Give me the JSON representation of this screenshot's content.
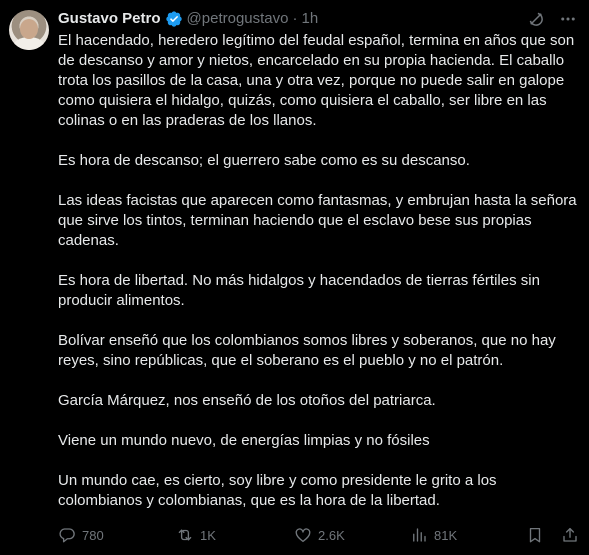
{
  "tweet": {
    "author_name": "Gustavo Petro",
    "handle": "@petrogustavo",
    "separator": "·",
    "timestamp": "1h",
    "paragraphs": [
      "El hacendado, heredero legítimo del feudal español, termina en años que son de descanso y amor y nietos, encarcelado en su propia hacienda. El caballo trota los pasillos de la casa, una y otra vez, porque no puede salir en galope como quisiera el hidalgo,  quizás, como quisiera el caballo, ser libre en las colinas  o en las praderas de los llanos.",
      "Es hora de descanso; el guerrero sabe como es su descanso.",
      "Las ideas facistas que aparecen como fantasmas, y embrujan hasta  la señora que sirve los tintos, terminan haciendo que el esclavo bese sus propias cadenas.",
      "Es hora de libertad. No más hidalgos y hacendados de tierras fértiles sin producir alimentos.",
      "Bolívar enseñó que los colombianos somos libres y soberanos, que no hay reyes, sino repúblicas, que el soberano es el pueblo y no el patrón.",
      "García Márquez, nos enseñó de los otoños del patriarca.",
      "Viene un mundo nuevo, de energías limpias y no fósiles",
      "Un mundo cae, es cierto, soy libre y como presidente le grito a los colombianos y colombianas, que es la hora de la libertad."
    ],
    "stats": {
      "replies": "780",
      "reposts": "1K",
      "likes": "2.6K",
      "views": "81K"
    }
  },
  "icons": {
    "verified": "verified-badge-icon",
    "grok": "grok-icon",
    "more": "more-icon",
    "reply": "reply-icon",
    "repost": "repost-icon",
    "like": "heart-icon",
    "views": "views-icon",
    "bookmark": "bookmark-icon",
    "share": "share-icon"
  },
  "colors": {
    "background": "#000000",
    "text": "#e7e9ea",
    "secondary": "#71767b",
    "verified": "#1d9bf0"
  }
}
